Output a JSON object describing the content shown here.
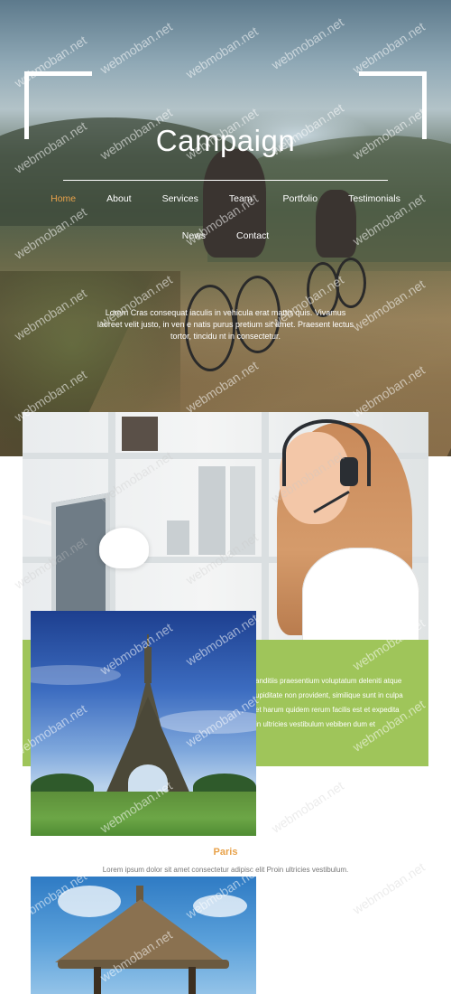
{
  "header": {
    "site_title": "Campaign",
    "nav_row1": [
      {
        "label": "Home",
        "active": true
      },
      {
        "label": "About"
      },
      {
        "label": "Services"
      },
      {
        "label": "Team"
      },
      {
        "label": "Portfolio"
      },
      {
        "label": "Testimonials"
      }
    ],
    "nav_row2": [
      {
        "label": "News"
      },
      {
        "label": "Contact"
      }
    ],
    "hero_text": "Lorem Cras consequat iaculis in vehicula erat mattis quis. Vivamus laoreet velit justo, in ven e natis purus pretium sit amet. Praesent lectus tortor, tincidu nt in consectetur."
  },
  "feature": {
    "panel_lines": [
      "anditiis praesentium voluptatum deleniti atque",
      "upiditate non provident, similique sunt in culpa",
      "et harum quidem rerum facilis est et expedita",
      "in ultricies vestibulum vebiben dum et"
    ]
  },
  "gallery": {
    "paris_title": "Paris",
    "paris_text": "Lorem ipsum dolor sit amet consectetur adipisc elit Proin ultricies vestibulum."
  },
  "watermark": "webmoban.net",
  "colors": {
    "accent_orange": "#e8a24a",
    "panel_green": "#9fc55a",
    "white": "#ffffff"
  },
  "icons": {
    "hero_frame": "corner-bracket"
  }
}
